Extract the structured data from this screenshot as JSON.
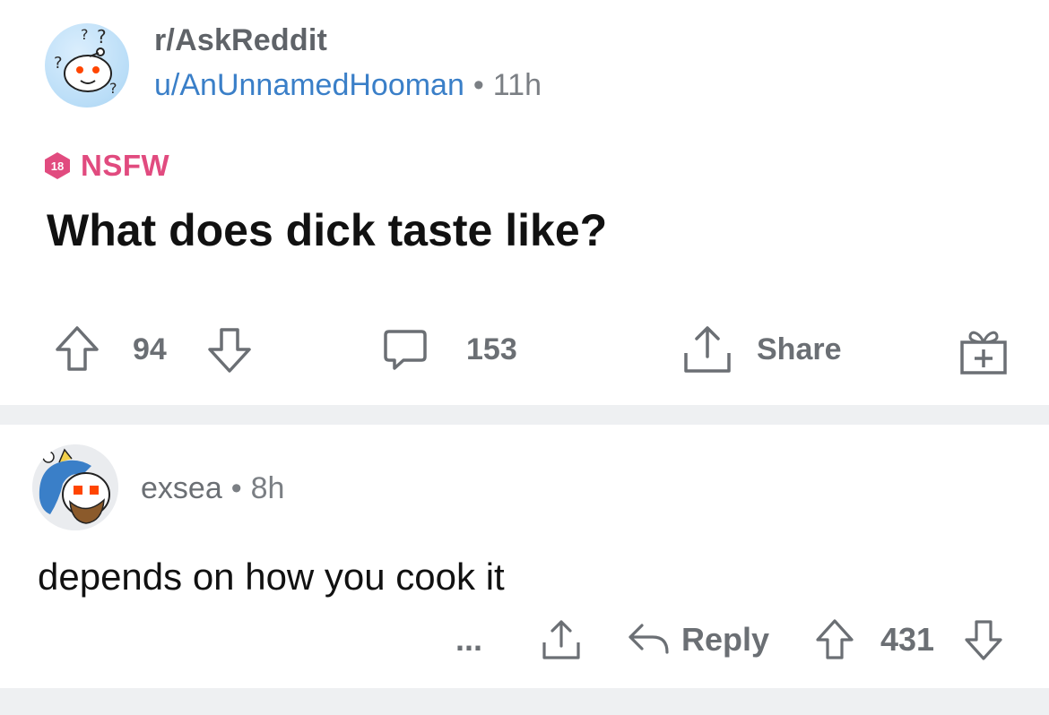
{
  "post": {
    "subreddit": "r/AskReddit",
    "author": "u/AnUnnamedHooman",
    "separator": "•",
    "age": "11h",
    "nsfw_badge": "18",
    "nsfw_label": "NSFW",
    "title": "What does dick taste like?",
    "upvotes": "94",
    "comments": "153",
    "share_label": "Share",
    "icons": [
      "upvote-icon",
      "downvote-icon",
      "comment-icon",
      "share-icon",
      "award-icon"
    ]
  },
  "comment": {
    "author": "exsea",
    "separator": "•",
    "age": "8h",
    "body": "depends on how you cook it",
    "more_label": "...",
    "reply_label": "Reply",
    "score": "431",
    "icons": [
      "more-icon",
      "share-icon",
      "reply-icon",
      "upvote-icon",
      "downvote-icon"
    ]
  },
  "colors": {
    "nsfw": "#e14b7f",
    "user_link": "#3a7fc8",
    "muted": "#6b6f74",
    "separator_bg": "#eef0f2"
  }
}
